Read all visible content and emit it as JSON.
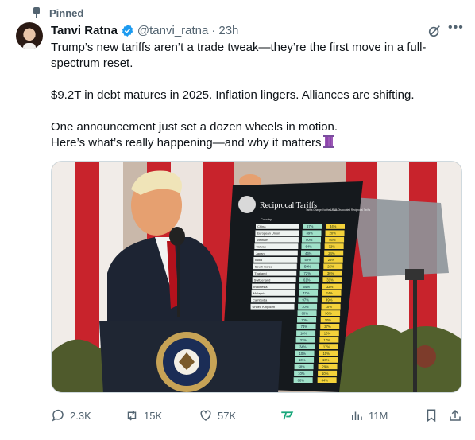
{
  "pinned_label": "Pinned",
  "author": {
    "name": "Tanvi Ratna",
    "handle": "@tanvi_ratna",
    "separator": "·",
    "time": "23h"
  },
  "tweet": {
    "p1": "Trump’s new tariffs aren’t a trade tweak—they’re the first move in a full-spectrum reset.",
    "p2": "$9.2T in debt matures in 2025. Inflation lingers. Alliances are shifting.",
    "p3": "One announcement just set a dozen wheels in motion.\nHere’s what’s really happening—and why it matters"
  },
  "media": {
    "board_title": "Reciprocal Tariffs",
    "board_col_country": "Country",
    "board_col_charged": "Tariffs Charged to the U.S.A.",
    "board_col_reciprocal": "U.S.A. Discounted Reciprocal Tariffs",
    "countries": [
      "China",
      "European Union",
      "Vietnam",
      "Taiwan",
      "Japan",
      "India",
      "South Korea",
      "Thailand",
      "Switzerland",
      "Indonesia",
      "Malaysia",
      "Cambodia",
      "United Kingdom"
    ],
    "charged": [
      "67%",
      "39%",
      "90%",
      "64%",
      "46%",
      "52%",
      "50%",
      "72%",
      "61%",
      "64%",
      "47%",
      "97%",
      "10%",
      "60%",
      "10%",
      "74%",
      "10%",
      "33%",
      "34%",
      "10%",
      "10%",
      "58%",
      "10%",
      "88%"
    ],
    "reciprocal": [
      "34%",
      "20%",
      "46%",
      "32%",
      "24%",
      "26%",
      "25%",
      "36%",
      "31%",
      "32%",
      "24%",
      "49%",
      "10%",
      "30%",
      "10%",
      "37%",
      "10%",
      "17%",
      "17%",
      "10%",
      "10%",
      "29%",
      "10%",
      "44%"
    ],
    "seal_text": "SEAL OF THE PRESIDENT OF THE UNITED STATES"
  },
  "actions": {
    "replies": "2.3K",
    "reposts": "15K",
    "likes": "57K",
    "views": "11M"
  },
  "colors": {
    "text": "#0f1419",
    "muted": "#536471",
    "verified": "#1d9bf0",
    "board_green": "#9fe0c8",
    "board_yellow": "#f4d23a"
  }
}
